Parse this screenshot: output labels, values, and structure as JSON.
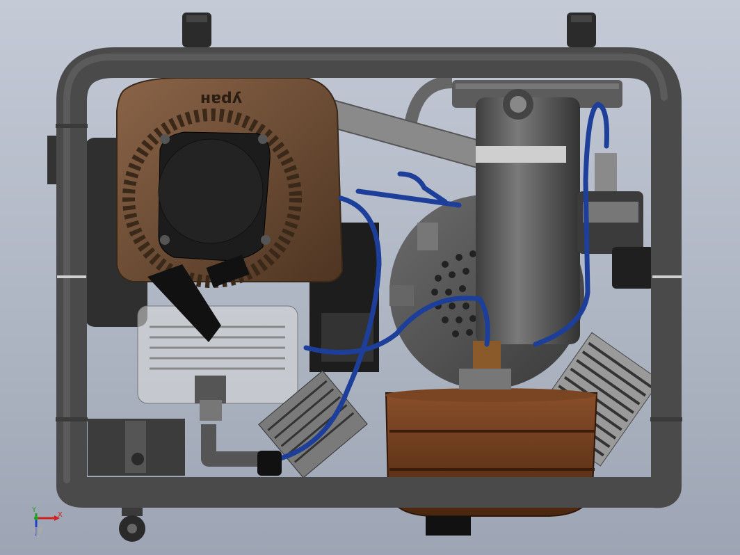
{
  "viewport": {
    "background_top": "#c4cad6",
    "background_bottom": "#9da5b4"
  },
  "model": {
    "engine_cover_text": "yран",
    "colors": {
      "frame": "#4a4a4a",
      "engine_cover": "#6b4a30",
      "cylinder_guard": "#8a8a8a",
      "hose": "#1d3f9a",
      "oil_tank": "#6b3a1c",
      "filter_body": "#5a5a5a"
    }
  },
  "triad": {
    "x_label": "X",
    "y_label": "Y",
    "x_color": "#d02020",
    "y_color": "#20a020",
    "z_color": "#2040d0"
  }
}
